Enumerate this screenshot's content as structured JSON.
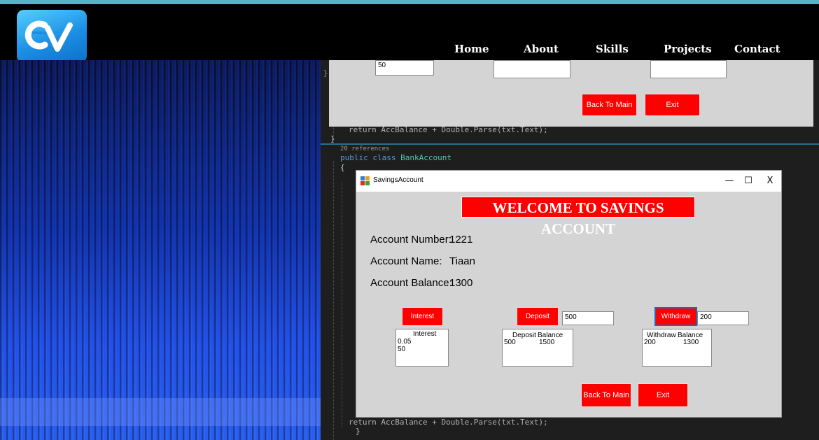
{
  "nav": {
    "logo_text": "CV",
    "links": [
      "Home",
      "About",
      "Skills",
      "Projects",
      "Contact"
    ]
  },
  "code": {
    "line_top": "return AccBalance + Double.Parse(txt.Text);",
    "references": "20 references",
    "class_decl": "public class BankAccount",
    "brace_open": "{",
    "brace_close": "}",
    "line_bottom": "return AccBalance + Double.Parse(txt.Text);"
  },
  "background_form": {
    "box1_value": "50",
    "back_button": "Back To Main",
    "exit_button": "Exit"
  },
  "window": {
    "title": "SavingsAccount",
    "controls": {
      "minimize": "—",
      "maximize": "☐",
      "close": "X"
    },
    "banner": "WELCOME TO SAVINGS ACCOUNT",
    "account_number_label": "Account Number:",
    "account_number": "1221",
    "account_name_label": "Account Name:",
    "account_name": "Tiaan",
    "account_balance_label": "Account Balance:",
    "account_balance": "1300",
    "interest_button": "Interest",
    "interest_list": {
      "header": "Interest",
      "row1": "0.05",
      "row2": "50"
    },
    "deposit_button": "Deposit",
    "deposit_input": "500",
    "deposit_list": {
      "h1": "Deposit",
      "h2": "Balance",
      "v1": "500",
      "v2": "1500"
    },
    "withdraw_button": "Withdraw",
    "withdraw_input": "200",
    "withdraw_list": {
      "h1": "Withdraw",
      "h2": "Balance",
      "v1": "200",
      "v2": "1300"
    },
    "back_button": "Back To Main",
    "exit_button": "Exit"
  },
  "colors": {
    "accent": "#ff0000",
    "nav_bg": "#000000",
    "form_bg": "#d4d4d4"
  }
}
